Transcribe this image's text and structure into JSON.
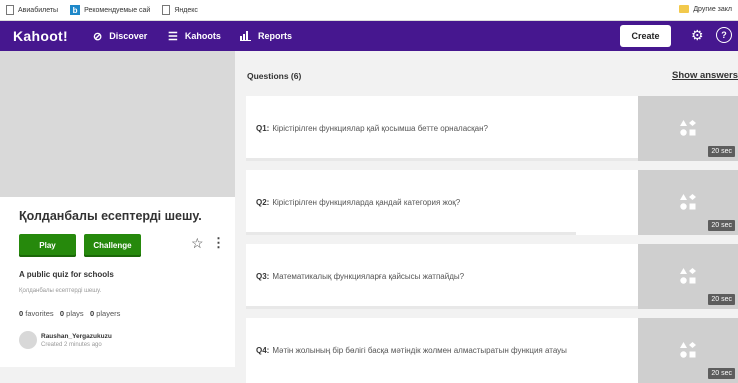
{
  "bookmarks": {
    "items": [
      {
        "label": "Авиабилеты",
        "icon": "page-icon"
      },
      {
        "label": "Рекомендуемые сай",
        "icon": "bing-icon"
      },
      {
        "label": "Яндекс",
        "icon": "page-icon"
      }
    ],
    "other": "Другие закл"
  },
  "nav": {
    "logo": "Kahoot!",
    "discover": "Discover",
    "kahoots": "Kahoots",
    "reports": "Reports",
    "create": "Create",
    "help": "?"
  },
  "quiz": {
    "title": "Қолданбалы есептерді шешу.",
    "play": "Play",
    "challenge": "Challenge",
    "visibility": "A public quiz for schools",
    "subtitle": "Қолданбалы есептерді шешу.",
    "favorites_count": "0",
    "favorites_label": "favorites",
    "plays_count": "0",
    "plays_label": "plays",
    "players_count": "0",
    "players_label": "players",
    "author": "Raushan_Yergazukuzu",
    "created": "Created 2 minutes ago"
  },
  "questions": {
    "header": "Questions (6)",
    "show_answers": "Show answers",
    "items": [
      {
        "num": "Q1:",
        "text": "Кірістірілген функциялар қай қосымша бетте орналасқан?",
        "time": "20 sec"
      },
      {
        "num": "Q2:",
        "text": "Кірістірілген функцияларда қандай категория жоқ?",
        "time": "20 sec"
      },
      {
        "num": "Q3:",
        "text": "Математикалық функцияларға қайсысы жатпайды?",
        "time": "20 sec"
      },
      {
        "num": "Q4:",
        "text": "Мәтін жолының бір бөлігі басқа мәтіндік жолмен алмастыратын функция атауы",
        "time": "20 sec"
      }
    ]
  },
  "colors": {
    "nav_bg": "#46178f",
    "play_green": "#26890c",
    "thumb_gray": "#cfcfcf"
  }
}
